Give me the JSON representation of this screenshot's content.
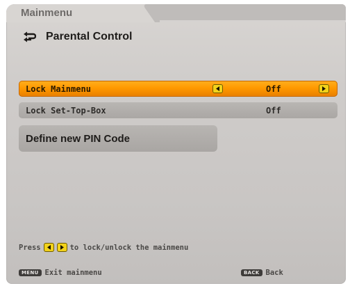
{
  "header": {
    "breadcrumb": "Mainmenu",
    "title": "Parental Control",
    "title_icon": "return-arrow-icon"
  },
  "menu": {
    "items": [
      {
        "label": "Lock Mainmenu",
        "value": "Off",
        "selected": true
      },
      {
        "label": "Lock Set-Top-Box",
        "value": "Off",
        "selected": false
      }
    ],
    "pin_button_label": "Define new PIN Code"
  },
  "hint": {
    "prefix": "Press",
    "suffix": "to lock/unlock the mainmenu"
  },
  "footer": {
    "exit_key": "MENU",
    "exit_label": "Exit mainmenu",
    "back_key": "BACK",
    "back_label": "Back"
  },
  "colors": {
    "selected_row": "#ff9900",
    "panel_bg": "#cfccca",
    "arrow_button": "#f2d21a"
  }
}
